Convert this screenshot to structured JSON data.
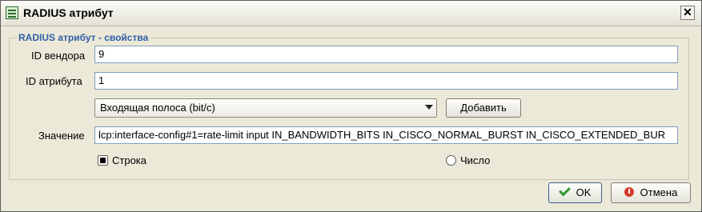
{
  "window": {
    "title": "RADIUS атрибут",
    "close_glyph": "✕"
  },
  "group": {
    "title": "RADIUS атрибут - свойства"
  },
  "fields": {
    "vendor_id_label": "ID вендора",
    "vendor_id_value": "9",
    "attribute_id_label": "ID атрибута",
    "attribute_id_value": "1",
    "value_label": "Значение",
    "value_text": "lcp:interface-config#1=rate-limit input IN_BANDWIDTH_BITS IN_CISCO_NORMAL_BURST IN_CISCO_EXTENDED_BUR"
  },
  "preset": {
    "selected": "Входящая полоса (bit/c)",
    "add_label": "Добавить"
  },
  "type_options": {
    "string_label": "Строка",
    "number_label": "Число",
    "selected": "string"
  },
  "buttons": {
    "ok_label": "OK",
    "cancel_label": "Отмена"
  },
  "icons": {
    "app": "table-icon",
    "ok": "checkmark-icon",
    "cancel": "cancel-icon"
  },
  "colors": {
    "group_title": "#2f5ea8",
    "input_border": "#7f9db9",
    "ok_check": "#2e9b2e",
    "cancel_red": "#d63a2a"
  }
}
